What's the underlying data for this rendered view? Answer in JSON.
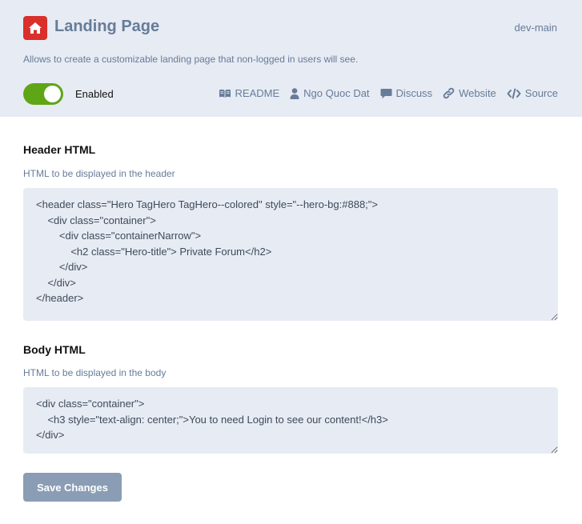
{
  "extension": {
    "title": "Landing Page",
    "version": "dev-main",
    "description": "Allows to create a customizable landing page that non-logged in users will see.",
    "icon": "home-icon",
    "icon_bg": "#d9302b",
    "status_label": "Enabled",
    "enabled": true
  },
  "links": {
    "readme": "README",
    "author": "Ngo Quoc Dat",
    "discuss": "Discuss",
    "website": "Website",
    "source": "Source"
  },
  "settings": {
    "header_title": "Header HTML",
    "header_help": "HTML to be displayed in the header",
    "header_value": "<header class=\"Hero TagHero TagHero--colored\" style=\"--hero-bg:#888;\">\n    <div class=\"container\">\n        <div class=\"containerNarrow\">\n            <h2 class=\"Hero-title\"> Private Forum</h2>\n        </div>\n    </div>\n</header>",
    "body_title": "Body HTML",
    "body_help": "HTML to be displayed in the body",
    "body_value": "<div class=\"container\">\n    <h3 style=\"text-align: center;\">You to need Login to see our content!</h3>\n</div>"
  },
  "save_label": "Save Changes",
  "colors": {
    "header_bg": "#e7ebf3",
    "muted_text": "#667c99",
    "toggle_on": "#5ea615",
    "button_bg": "#8a9db5"
  }
}
